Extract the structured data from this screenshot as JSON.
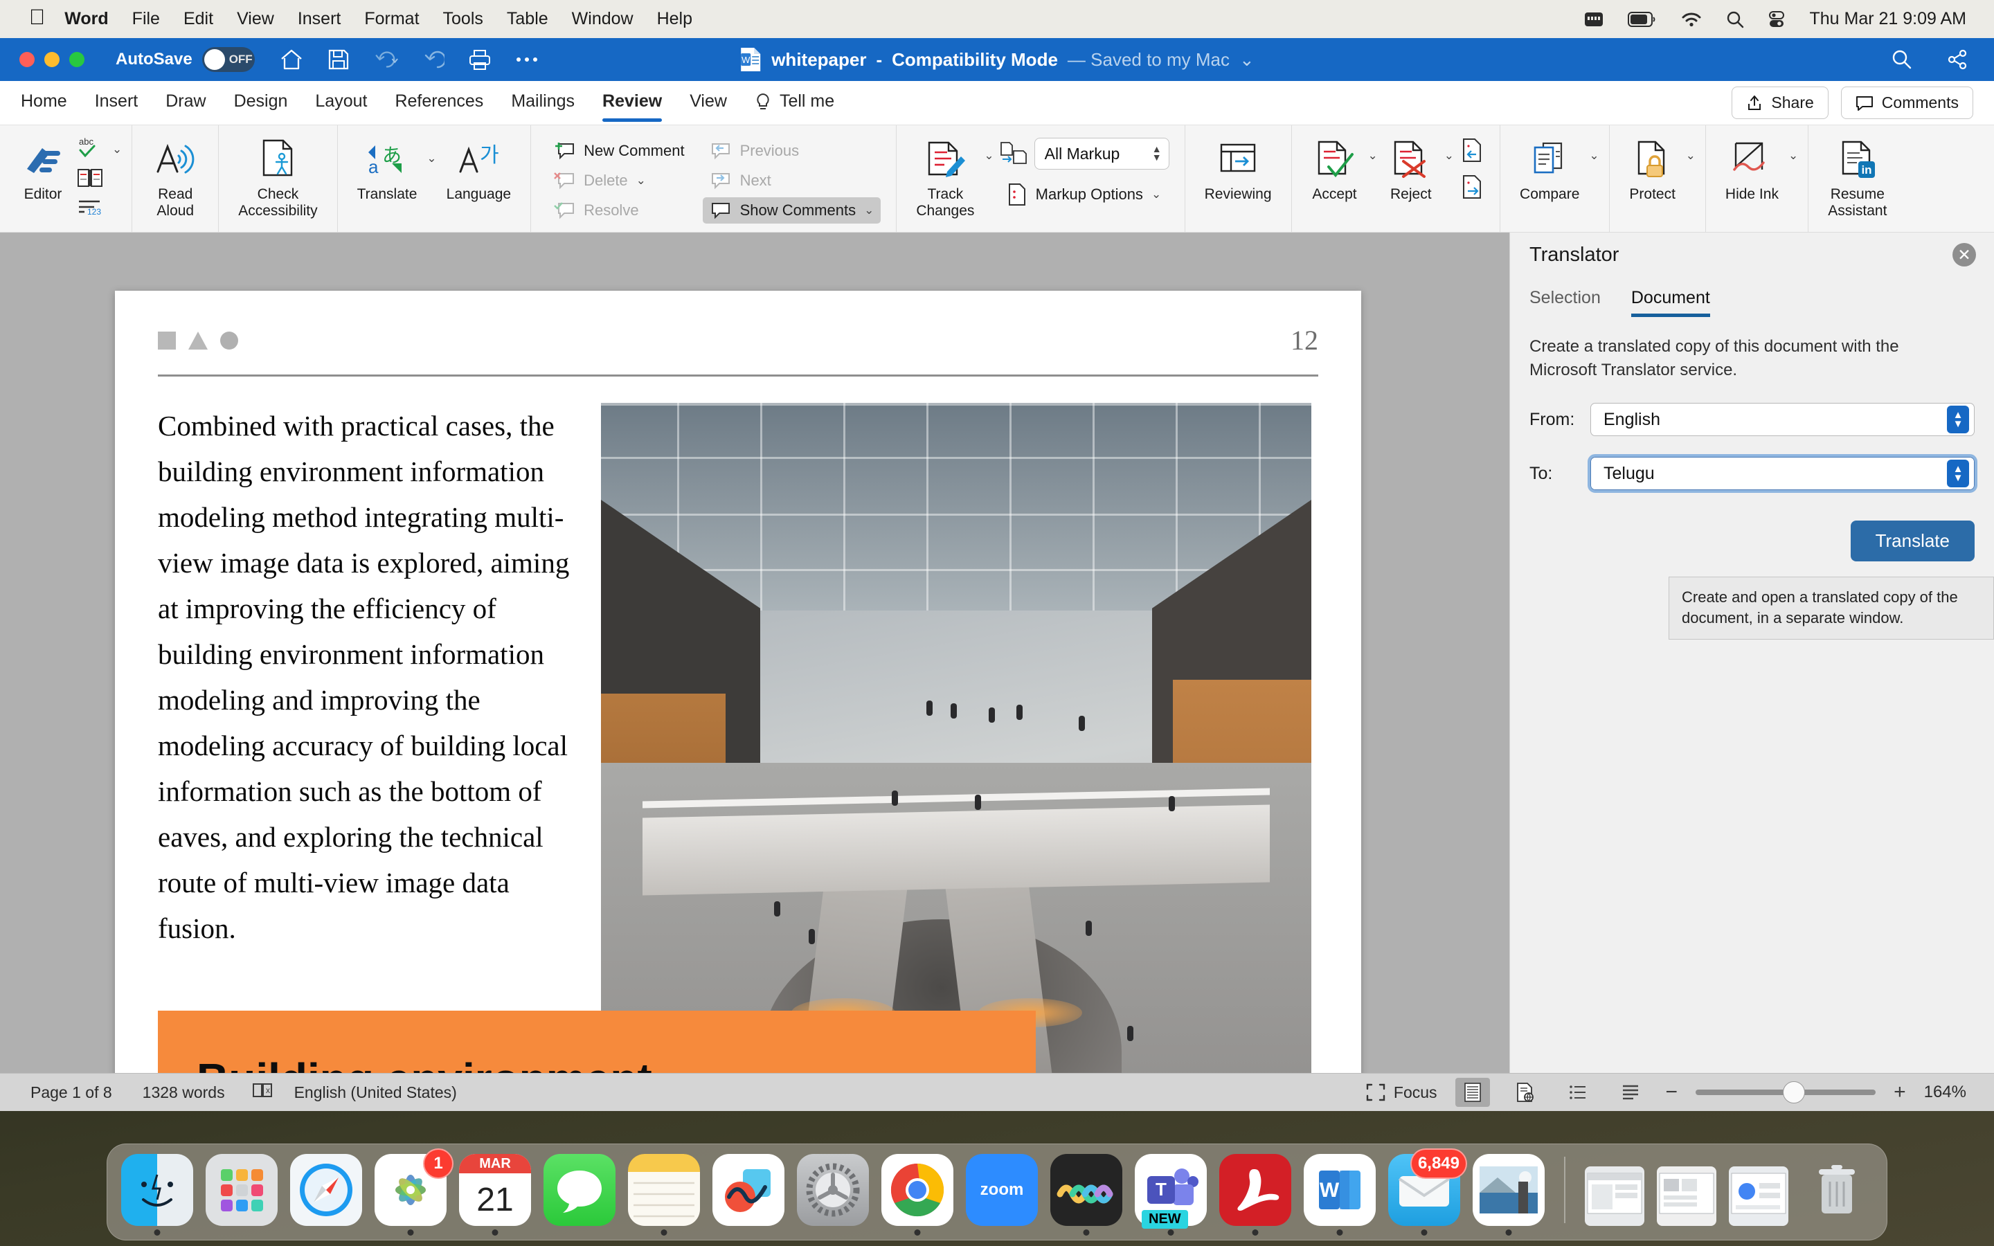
{
  "menubar": {
    "apple_icon": "apple-icon",
    "items": [
      {
        "label": "Word",
        "bold": true
      },
      {
        "label": "File",
        "bold": false
      },
      {
        "label": "Edit",
        "bold": false
      },
      {
        "label": "View",
        "bold": false
      },
      {
        "label": "Insert",
        "bold": false
      },
      {
        "label": "Format",
        "bold": false
      },
      {
        "label": "Tools",
        "bold": false
      },
      {
        "label": "Table",
        "bold": false
      },
      {
        "label": "Window",
        "bold": false
      },
      {
        "label": "Help",
        "bold": false
      }
    ],
    "status_icons": [
      "keyboard-icon",
      "battery-icon",
      "wifi-icon",
      "spotlight-search-icon",
      "control-center-icon"
    ],
    "clock": "Thu Mar 21  9:09 AM"
  },
  "titlebar": {
    "autosave_label": "AutoSave",
    "autosave_state": "OFF",
    "quick_access": [
      "home-icon",
      "save-icon",
      "undo-icon",
      "redo-icon",
      "print-icon",
      "more-icon"
    ],
    "doc_name": "whitepaper",
    "separator": "-",
    "mode": "Compatibility Mode",
    "saved_state": "— Saved to my Mac",
    "right_icons": [
      "search-icon",
      "share-window-icon"
    ],
    "accent_color": "#1668c4"
  },
  "tabs": {
    "items": [
      "Home",
      "Insert",
      "Draw",
      "Design",
      "Layout",
      "References",
      "Mailings",
      "Review",
      "View"
    ],
    "active": "Review",
    "tell_me": "Tell me",
    "share_label": "Share",
    "comments_label": "Comments"
  },
  "ribbon": {
    "groups": [
      {
        "name": "proofing",
        "buttons": [
          {
            "label": "Editor",
            "icon": "editor-pen-icon"
          }
        ],
        "small": [
          {
            "label": "",
            "icon": "spelling-abc-check-icon"
          },
          {
            "label": "",
            "icon": "thesaurus-book-icon"
          },
          {
            "label": "",
            "icon": "word-count-icon"
          }
        ]
      },
      {
        "name": "speech",
        "buttons": [
          {
            "label": "Read\nAloud",
            "icon": "read-aloud-icon"
          }
        ]
      },
      {
        "name": "accessibility",
        "buttons": [
          {
            "label": "Check\nAccessibility",
            "icon": "check-accessibility-icon"
          }
        ]
      },
      {
        "name": "language",
        "buttons": [
          {
            "label": "Translate",
            "icon": "translate-icon"
          },
          {
            "label": "Language",
            "icon": "language-icon"
          }
        ]
      },
      {
        "name": "comments",
        "small": [
          {
            "label": "New Comment",
            "icon": "new-comment-icon",
            "state": "enabled"
          },
          {
            "label": "Delete",
            "icon": "delete-comment-icon",
            "state": "disabled"
          },
          {
            "label": "Resolve",
            "icon": "resolve-comment-icon",
            "state": "disabled"
          },
          {
            "label": "Previous",
            "icon": "previous-comment-icon",
            "state": "disabled"
          },
          {
            "label": "Next",
            "icon": "next-comment-icon",
            "state": "disabled"
          },
          {
            "label": "Show Comments",
            "icon": "show-comments-icon",
            "state": "active"
          }
        ]
      },
      {
        "name": "tracking",
        "buttons": [
          {
            "label": "Track\nChanges",
            "icon": "track-changes-icon"
          }
        ],
        "markup_value": "All Markup",
        "markup_options_label": "Markup Options",
        "reviewing_label": "Reviewing"
      },
      {
        "name": "changes",
        "buttons": [
          {
            "label": "Accept",
            "icon": "accept-change-icon"
          },
          {
            "label": "Reject",
            "icon": "reject-change-icon"
          }
        ],
        "nav": [
          "previous-change-icon",
          "next-change-icon"
        ]
      },
      {
        "name": "compare",
        "buttons": [
          {
            "label": "Compare",
            "icon": "compare-icon"
          }
        ]
      },
      {
        "name": "protect",
        "buttons": [
          {
            "label": "Protect",
            "icon": "protect-lock-icon"
          }
        ]
      },
      {
        "name": "ink",
        "buttons": [
          {
            "label": "Hide Ink",
            "icon": "hide-ink-icon"
          }
        ]
      },
      {
        "name": "resume",
        "buttons": [
          {
            "label": "Resume\nAssistant",
            "icon": "resume-assistant-linkedin-icon"
          }
        ]
      }
    ]
  },
  "document": {
    "page_number": "12",
    "header_shapes": [
      "square-shape",
      "triangle-shape",
      "circle-shape"
    ],
    "body_text": "Combined with practical cases, the building environment information modeling method integrating multi-view image data is explored, aiming at improving the efficiency of building environment information modeling and improving the modeling accuracy of building local information such as the bottom of eaves, and exploring the technical route of multi-view image data fusion.",
    "banner_heading": "Building environment",
    "banner_color": "#f68a3c",
    "image_alt": "atrium-photo"
  },
  "translator": {
    "title": "Translator",
    "close_icon": "close-icon",
    "tabs": [
      "Selection",
      "Document"
    ],
    "active_tab": "Document",
    "description": "Create a translated copy of this document with the Microsoft Translator service.",
    "from_label": "From:",
    "from_value": "English",
    "to_label": "To:",
    "to_value": "Telugu",
    "translate_button": "Translate",
    "tooltip": "Create and open a translated copy of the document, in a separate window."
  },
  "statusbar": {
    "page_info": "Page 1 of 8",
    "word_count": "1328 words",
    "proofing_icon": "proofing-errors-icon",
    "language": "English (United States)",
    "focus_label": "Focus",
    "view_icons": [
      "print-layout-icon",
      "web-layout-icon",
      "outline-icon",
      "draft-icon"
    ],
    "active_view": "print-layout-icon",
    "zoom_minus": "−",
    "zoom_plus": "+",
    "zoom_level": "164%"
  },
  "dock": {
    "items": [
      {
        "name": "Finder",
        "icon": "finder-icon",
        "running": true
      },
      {
        "name": "Launchpad",
        "icon": "launchpad-icon",
        "running": false
      },
      {
        "name": "Safari",
        "icon": "safari-icon",
        "running": false
      },
      {
        "name": "Photos",
        "icon": "photos-icon",
        "running": true,
        "badge": "1"
      },
      {
        "name": "Calendar",
        "icon": "calendar-icon",
        "running": true,
        "month": "MAR",
        "day": "21"
      },
      {
        "name": "Messages",
        "icon": "messages-icon",
        "running": false
      },
      {
        "name": "Notes",
        "icon": "notes-icon",
        "running": true
      },
      {
        "name": "Freeform",
        "icon": "freeform-icon",
        "running": false
      },
      {
        "name": "System Settings",
        "icon": "system-settings-icon",
        "running": false
      },
      {
        "name": "Chrome",
        "icon": "chrome-icon",
        "running": true
      },
      {
        "name": "Zoom",
        "icon": "zoom-app-icon",
        "running": false
      },
      {
        "name": "Audio Hijack",
        "icon": "audio-wave-icon",
        "running": true
      },
      {
        "name": "Microsoft Teams",
        "icon": "teams-icon",
        "running": true,
        "tag": "NEW"
      },
      {
        "name": "Adobe Acrobat",
        "icon": "acrobat-icon",
        "running": true
      },
      {
        "name": "Microsoft Word",
        "icon": "word-icon",
        "running": true
      },
      {
        "name": "Mail",
        "icon": "mail-icon",
        "running": true,
        "badge": "6,849"
      },
      {
        "name": "Preview",
        "icon": "preview-photo-icon",
        "running": true
      }
    ],
    "minimized": [
      {
        "name": "window-thumb-1",
        "icon": "window-thumbnail-icon"
      },
      {
        "name": "window-thumb-2",
        "icon": "window-thumbnail-icon"
      },
      {
        "name": "window-thumb-3",
        "icon": "window-thumbnail-icon"
      }
    ],
    "trash": {
      "name": "Trash",
      "icon": "trash-icon"
    }
  }
}
